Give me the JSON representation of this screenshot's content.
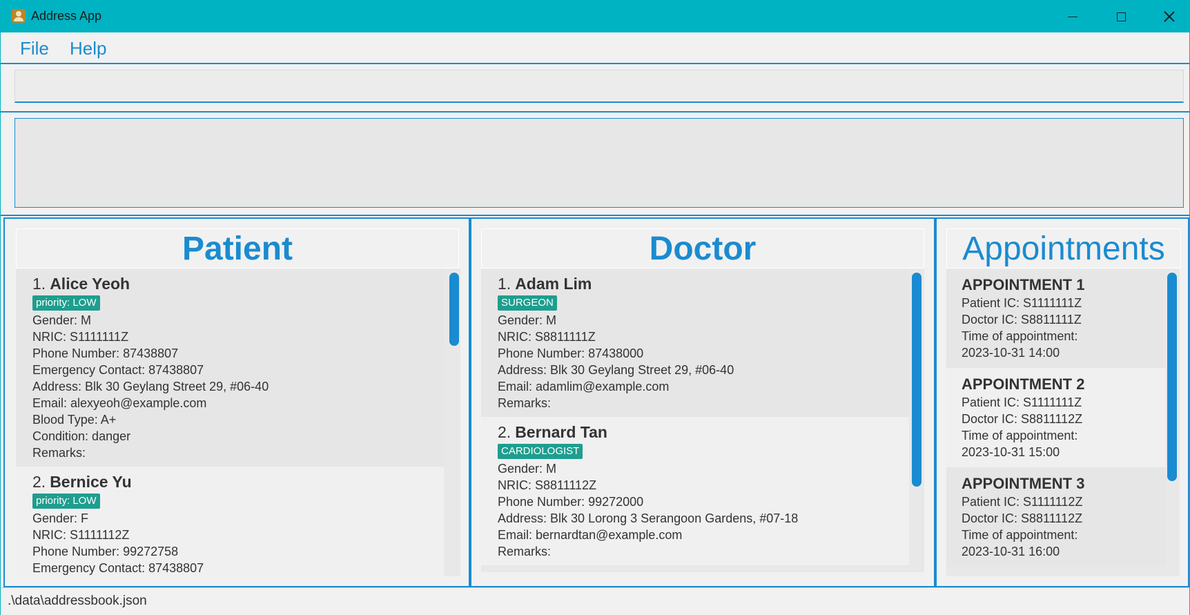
{
  "window": {
    "title": "Address App"
  },
  "menu": {
    "file": "File",
    "help": "Help"
  },
  "command": {
    "value": ""
  },
  "result": {
    "text": ""
  },
  "patient_panel": {
    "title": "Patient",
    "patients": [
      {
        "index": "1.",
        "name": "Alice Yeoh",
        "tag": "priority: LOW",
        "gender": "Gender: M",
        "nric": "NRIC: S1111111Z",
        "phone": "Phone Number: 87438807",
        "emergency": "Emergency Contact: 87438807",
        "address": "Address: Blk 30 Geylang Street 29, #06-40",
        "email": "Email: alexyeoh@example.com",
        "blood": "Blood Type: A+",
        "condition": "Condition: danger",
        "remarks": "Remarks:"
      },
      {
        "index": "2.",
        "name": "Bernice Yu",
        "tag": "priority: LOW",
        "gender": "Gender: F",
        "nric": "NRIC: S1111112Z",
        "phone": "Phone Number: 99272758",
        "emergency": "Emergency Contact: 87438807"
      }
    ]
  },
  "doctor_panel": {
    "title": "Doctor",
    "doctors": [
      {
        "index": "1.",
        "name": "Adam Lim",
        "tag": "SURGEON",
        "gender": "Gender: M",
        "nric": "NRIC: S8811111Z",
        "phone": "Phone Number: 87438000",
        "address": "Address: Blk 30 Geylang Street 29, #06-40",
        "email": "Email: adamlim@example.com",
        "remarks": "Remarks:"
      },
      {
        "index": "2.",
        "name": "Bernard Tan",
        "tag": "CARDIOLOGIST",
        "gender": "Gender: M",
        "nric": "NRIC: S8811112Z",
        "phone": "Phone Number: 99272000",
        "address": "Address: Blk 30 Lorong 3 Serangoon Gardens, #07-18",
        "email": "Email: bernardtan@example.com",
        "remarks": "Remarks:"
      }
    ]
  },
  "appointment_panel": {
    "title": "Appointments",
    "appointments": [
      {
        "title": "APPOINTMENT 1",
        "patient_ic": "Patient IC: S1111111Z",
        "doctor_ic": "Doctor IC: S8811111Z",
        "time_label": "Time of appointment:",
        "time": "2023-10-31 14:00"
      },
      {
        "title": "APPOINTMENT 2",
        "patient_ic": "Patient IC: S1111111Z",
        "doctor_ic": "Doctor IC: S8811112Z",
        "time_label": "Time of appointment:",
        "time": "2023-10-31 15:00"
      },
      {
        "title": "APPOINTMENT 3",
        "patient_ic": "Patient IC: S1111112Z",
        "doctor_ic": "Doctor IC: S8811112Z",
        "time_label": "Time of appointment:",
        "time": "2023-10-31 16:00"
      }
    ]
  },
  "status": {
    "path": ".\\data\\addressbook.json"
  }
}
